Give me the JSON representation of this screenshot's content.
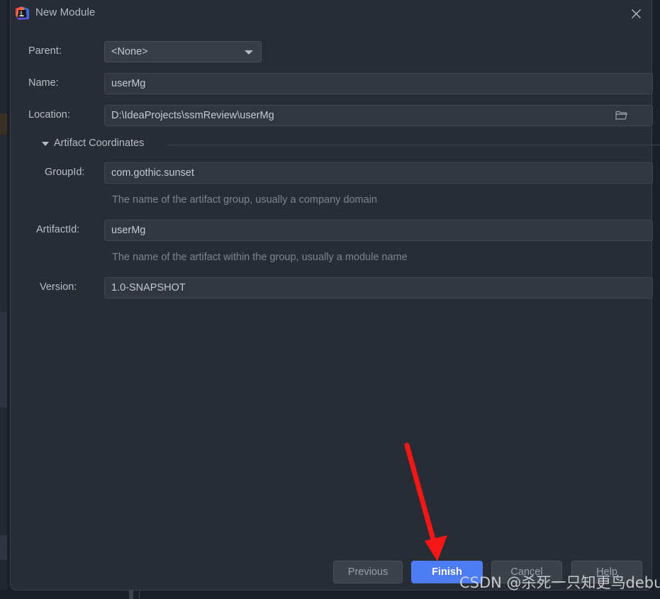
{
  "window": {
    "title": "New Module",
    "app_icon": "intellij-idea-icon",
    "close_icon": "close-icon"
  },
  "form": {
    "parent": {
      "label": "Parent:",
      "value": "<None>",
      "chevron_icon": "chevron-down-icon"
    },
    "name": {
      "label": "Name:",
      "value": "userMg"
    },
    "location": {
      "label": "Location:",
      "value": "D:\\IdeaProjects\\ssmReview\\userMg",
      "browse_icon": "folder-icon"
    }
  },
  "artifact_section": {
    "title": "Artifact Coordinates",
    "expanded": true,
    "triangle_icon": "triangle-down-icon",
    "group_id": {
      "label": "GroupId:",
      "value": "com.gothic.sunset",
      "hint": "The name of the artifact group, usually a company domain"
    },
    "artifact_id": {
      "label": "ArtifactId:",
      "value": "userMg",
      "hint": "The name of the artifact within the group, usually a module name"
    },
    "version": {
      "label": "Version:",
      "value": "1.0-SNAPSHOT"
    }
  },
  "buttons": {
    "previous": "Previous",
    "finish": "Finish",
    "cancel": "Cancel",
    "help": "Help"
  },
  "annotation": {
    "arrow_color": "#f71616",
    "points_to": "finish-button"
  },
  "watermark": {
    "text": "CSDN @杀死一只知更鸟debug"
  },
  "colors": {
    "dialog_background": "#282c34",
    "field_background": "#32363e",
    "primary_button": "#4d7cf5",
    "label_text": "#b9bec7",
    "hint_text": "#7d8592"
  }
}
